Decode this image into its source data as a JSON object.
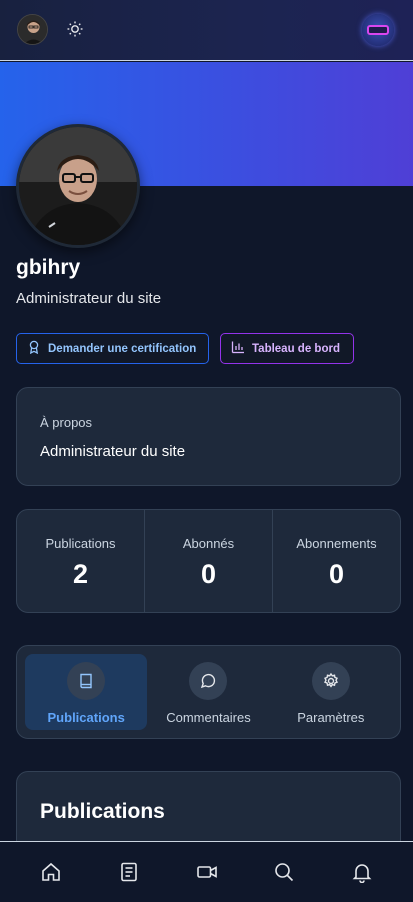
{
  "topbar": {
    "avatar": "user-avatar",
    "theme_icon": "sun-icon",
    "language_icon": "globe-icon"
  },
  "profile": {
    "username": "gbihry",
    "role": "Administrateur du site"
  },
  "actions": {
    "certification_label": "Demander une certification",
    "dashboard_label": "Tableau de bord"
  },
  "about": {
    "title": "À propos",
    "text": "Administrateur du site"
  },
  "stats": [
    {
      "label": "Publications",
      "value": "2"
    },
    {
      "label": "Abonnés",
      "value": "0"
    },
    {
      "label": "Abonnements",
      "value": "0"
    }
  ],
  "tabs": [
    {
      "label": "Publications",
      "icon": "book-icon",
      "active": true
    },
    {
      "label": "Commentaires",
      "icon": "comment-icon",
      "active": false
    },
    {
      "label": "Paramètres",
      "icon": "gear-icon",
      "active": false
    }
  ],
  "publications": {
    "title": "Publications"
  },
  "bottom_nav": [
    "home-icon",
    "notebook-icon",
    "video-icon",
    "search-icon",
    "bell-icon"
  ],
  "colors": {
    "accent": "#2563eb",
    "purple": "#9333ea",
    "background": "#0f172a",
    "card": "#1e293b"
  }
}
